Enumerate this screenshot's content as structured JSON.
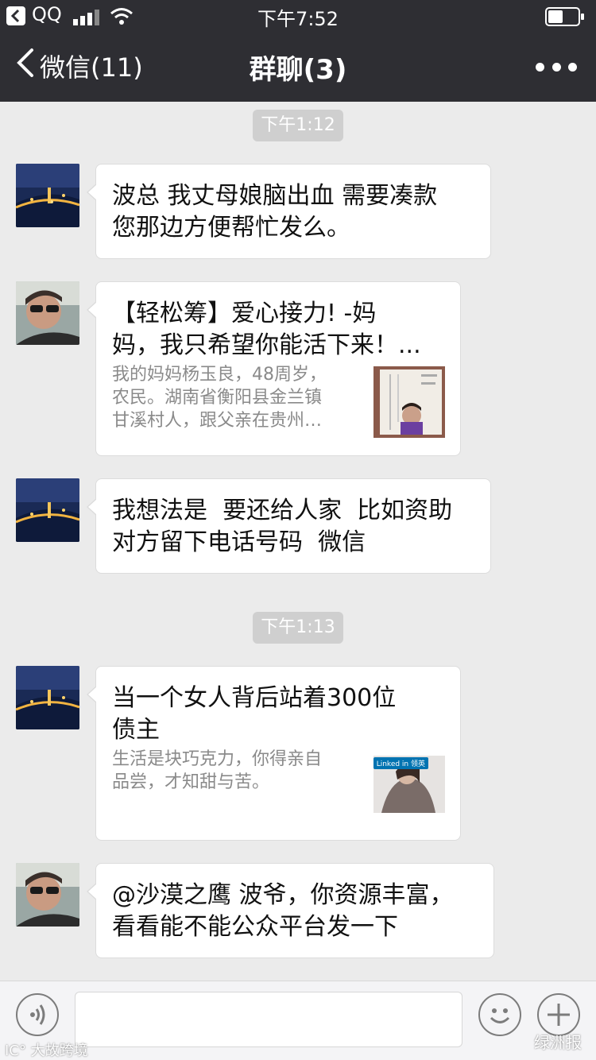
{
  "status_bar": {
    "back_app": "QQ",
    "time": "下午7:52"
  },
  "nav": {
    "back_label": "微信(11)",
    "title": "群聊(3)",
    "more_icon": "more-dots-icon"
  },
  "timestamps": [
    "下午1:12",
    "下午1:13"
  ],
  "messages": [
    {
      "sender_avatar": "city-night-avatar",
      "type": "text",
      "text": "波总 我丈母娘脑出血 需要凑款\n您那边方便帮忙发么。"
    },
    {
      "sender_avatar": "sunglasses-man-avatar",
      "type": "card",
      "title": "【轻松筹】爱心接力! -妈\n妈，我只希望你能活下来！...",
      "desc": "我的妈妈杨玉良，48周岁，\n农民。湖南省衡阳县金兰镇\n甘溪村人，跟父亲在贵州…",
      "thumb": "id-card-thumbnail"
    },
    {
      "sender_avatar": "city-night-avatar",
      "type": "text",
      "text": "我想法是  要还给人家  比如资助\n对方留下电话号码  微信"
    },
    {
      "sender_avatar": "city-night-avatar",
      "type": "card",
      "title": "当一个女人背后站着300位\n债主",
      "desc": "生活是块巧克力，你得亲自\n品尝，才知甜与苦。",
      "thumb": "woman-thumbnail",
      "thumb_badge": "Linked in 领英"
    },
    {
      "sender_avatar": "sunglasses-man-avatar",
      "type": "text",
      "text": "@沙漠之鹰 波爷，你资源丰富，\n看看能不能公众平台发一下"
    }
  ],
  "input_bar": {
    "voice_icon": "voice-icon",
    "emoji_icon": "emoji-icon",
    "plus_icon": "plus-icon",
    "text_value": ""
  },
  "watermarks": {
    "left": "IC° 大故跨境",
    "right": "绿洲报"
  },
  "colors": {
    "nav_bg": "#2e2e33",
    "chat_bg": "#ebebeb",
    "bubble_bg": "#ffffff",
    "timestamp_bg": "#cfcfcf"
  }
}
